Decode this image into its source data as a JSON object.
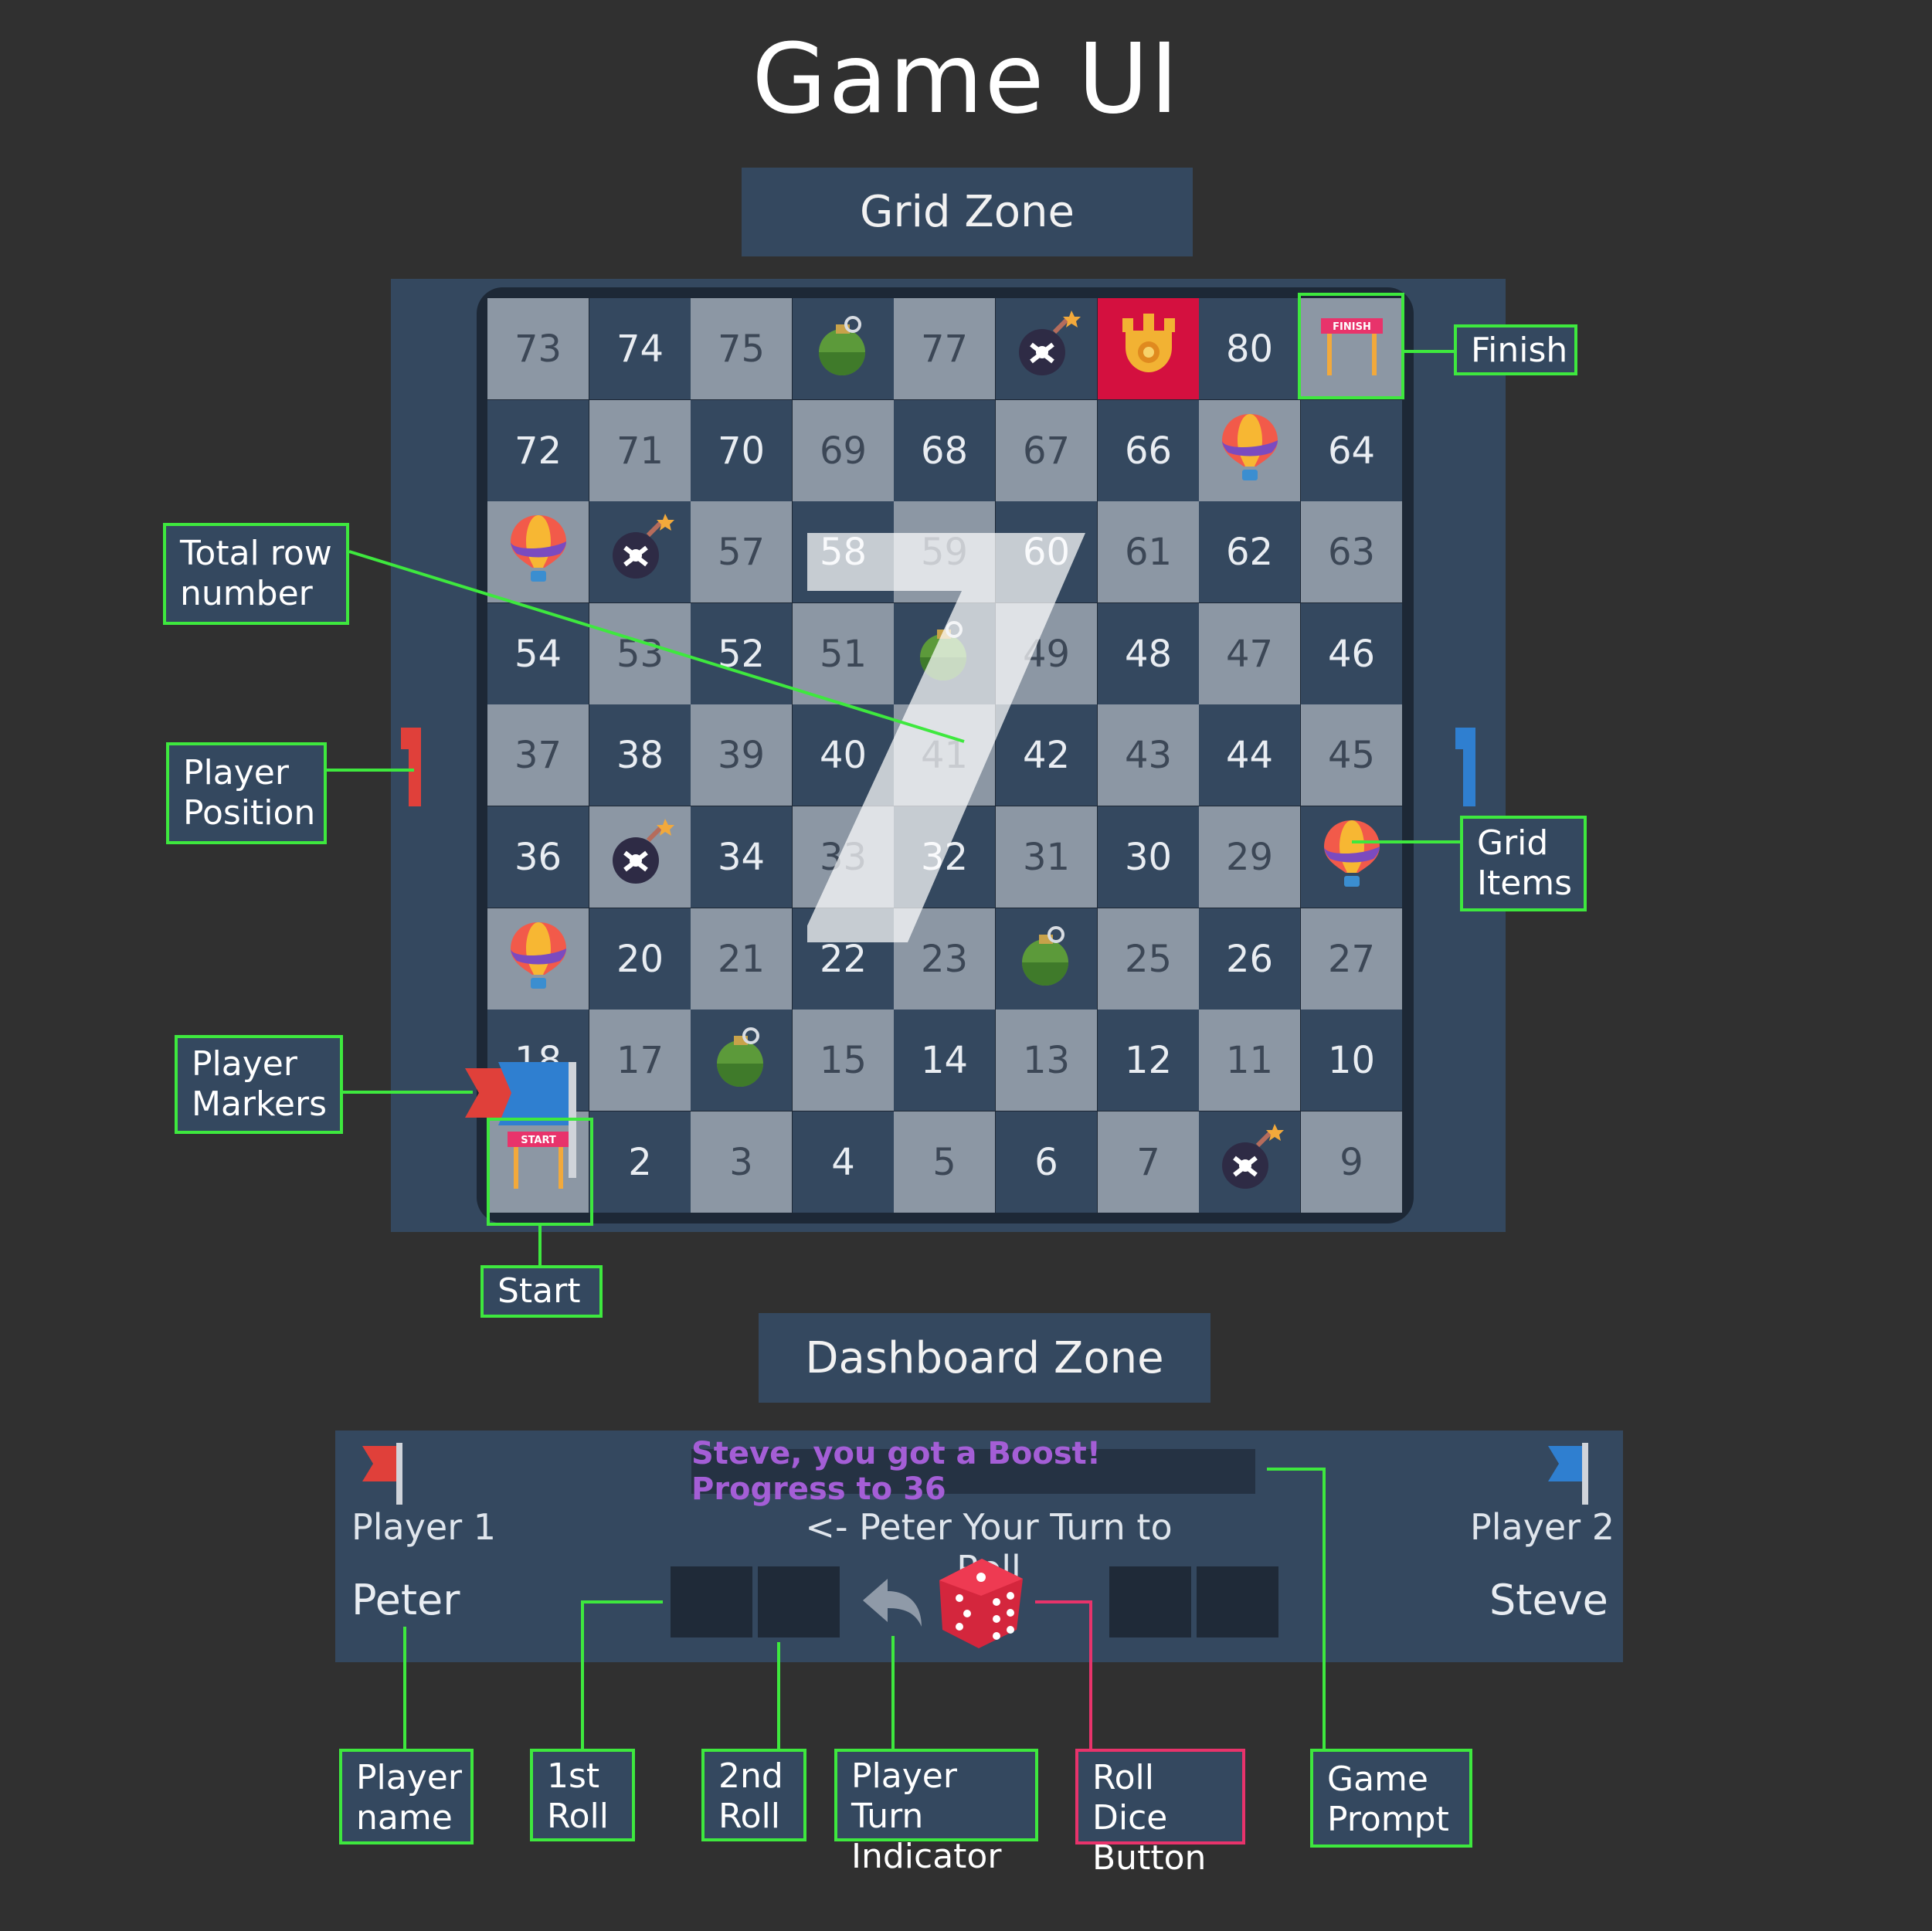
{
  "title": "Game UI",
  "zones": {
    "grid": "Grid Zone",
    "dashboard": "Dashboard Zone"
  },
  "board": {
    "rows": [
      [
        73,
        74,
        75,
        "green-bomb-icon",
        77,
        "black-bomb-icon",
        "trophy-icon",
        80,
        "finish-gate-icon"
      ],
      [
        72,
        71,
        70,
        69,
        68,
        67,
        66,
        "balloon-icon",
        64
      ],
      [
        "balloon-icon",
        "black-bomb-icon",
        57,
        58,
        59,
        60,
        61,
        62,
        63
      ],
      [
        54,
        53,
        52,
        51,
        "green-bomb-icon",
        49,
        48,
        47,
        46
      ],
      [
        37,
        38,
        39,
        40,
        41,
        42,
        43,
        44,
        45
      ],
      [
        36,
        "black-bomb-icon",
        34,
        33,
        32,
        31,
        30,
        29,
        "balloon-icon"
      ],
      [
        "balloon-icon",
        20,
        21,
        22,
        23,
        "green-bomb-icon",
        25,
        26,
        27
      ],
      [
        18,
        17,
        "green-bomb-icon",
        15,
        14,
        13,
        12,
        11,
        10
      ],
      [
        "start-gate-icon",
        2,
        3,
        4,
        5,
        6,
        7,
        "black-bomb-icon",
        9
      ]
    ],
    "total_row_number": "7",
    "player1_position": "1",
    "player2_position": "1",
    "finish_text": "FINISH",
    "start_text": "START"
  },
  "annotations": {
    "finish": "Finish",
    "total_row": "Total row\nnumber",
    "player_position": "Player\nPosition",
    "grid_items": "Grid\nItems",
    "player_markers": "Player\nMarkers",
    "start": "Start",
    "player_name": "Player\nname",
    "first_roll": "1st\nRoll",
    "second_roll": "2nd\nRoll",
    "turn_indicator": "Player Turn\nIndicator",
    "roll_dice": "Roll Dice\nButton",
    "game_prompt": "Game\nPrompt"
  },
  "dashboard": {
    "player1_label": "Player 1",
    "player1_name": "Peter",
    "player2_label": "Player 2",
    "player2_name": "Steve",
    "prompt": "Steve, you got a Boost! Progress to 36",
    "turn_text": "<- Peter Your Turn to Roll"
  },
  "colors": {
    "background": "#303030",
    "panel": "#34485f",
    "light_cell": "#8c97a4",
    "highlight_cell": "#d4103f",
    "annotation": "#3ee83e",
    "annotation_pink": "#e8336b",
    "player1": "#e0403a",
    "player2": "#2f7fd0",
    "prompt_text": "#a45ed6"
  }
}
